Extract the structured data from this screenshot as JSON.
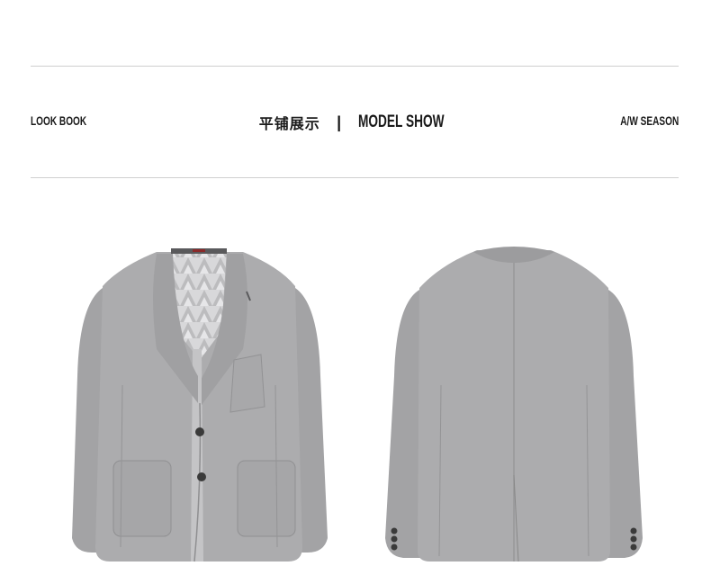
{
  "header": {
    "left_label": "LOOK BOOK",
    "title_cn": "平铺展示",
    "separator": "|",
    "title_en": "MODEL SHOW",
    "right_label": "A/W SEASON"
  },
  "images": [
    {
      "name": "blazer-front",
      "view": "front"
    },
    {
      "name": "blazer-back",
      "view": "back"
    }
  ],
  "colors": {
    "fabric": "#a9a9ab",
    "fabric_shadow": "#8e8e90",
    "lining": "#d4d4d6",
    "buttons": "#3a3a3a",
    "rule": "#cfcfcf"
  }
}
